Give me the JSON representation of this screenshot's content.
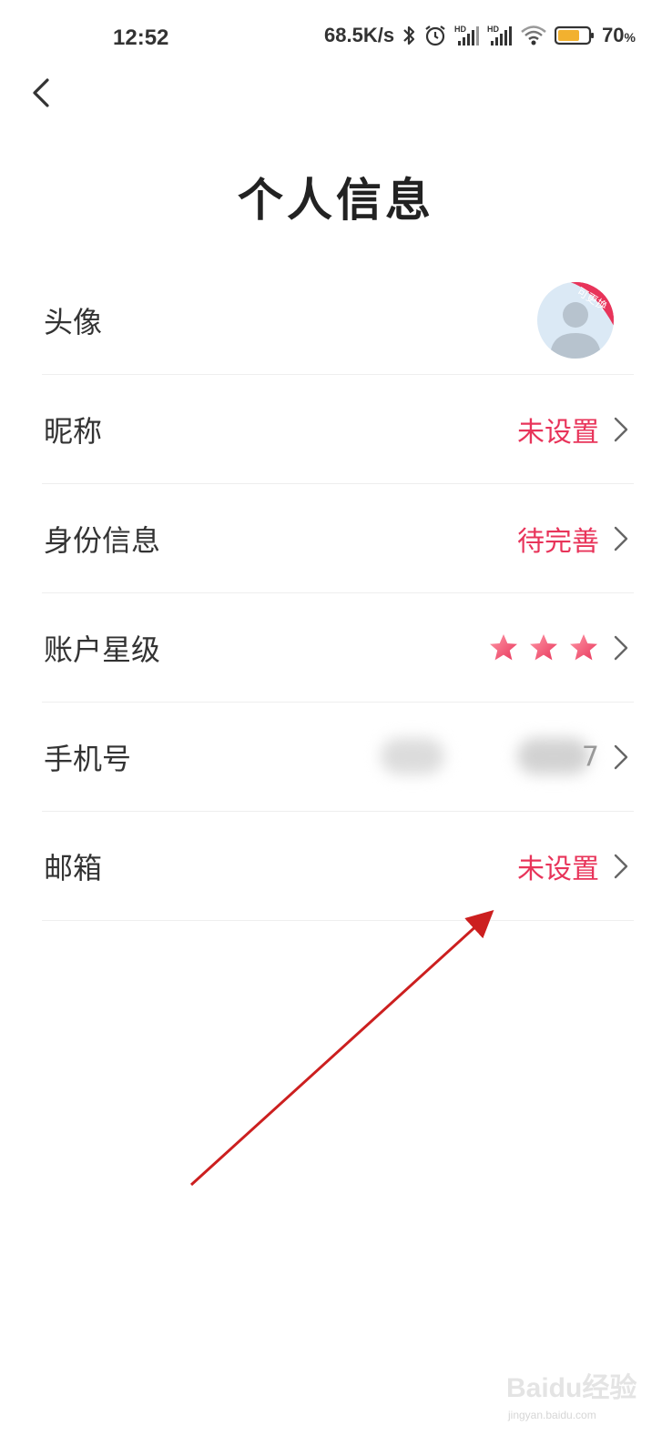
{
  "status_bar": {
    "time": "12:52",
    "net_speed": "68.5K/s",
    "battery_percent": "70",
    "battery_unit": "%",
    "icons": [
      "bluetooth-icon",
      "alarm-icon",
      "signal-hd-icon",
      "signal-hd-icon",
      "wifi-icon",
      "battery-icon"
    ],
    "hd_label": "HD"
  },
  "header": {
    "back_icon": "chevron-left-icon",
    "title": "个人信息"
  },
  "rows": [
    {
      "label": "头像",
      "avatar_badge": "可更换"
    },
    {
      "label": "昵称",
      "value": "未设置"
    },
    {
      "label": "身份信息",
      "value": "待完善"
    },
    {
      "label": "账户星级",
      "stars": 3
    },
    {
      "label": "手机号",
      "value_partial": "7"
    },
    {
      "label": "邮箱",
      "value": "未设置"
    }
  ],
  "colors": {
    "accent": "#e8345a",
    "annotation_arrow": "#cc1f1f"
  },
  "watermark": {
    "brand": "Baidu经验",
    "url": "jingyan.baidu.com"
  }
}
